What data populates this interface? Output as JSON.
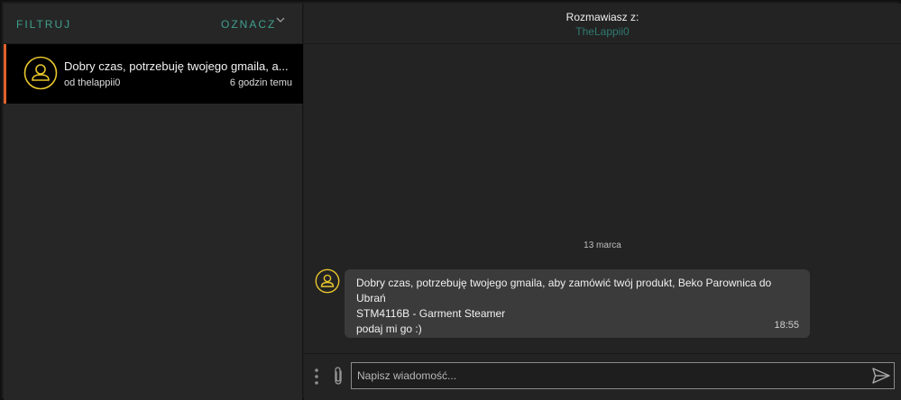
{
  "left": {
    "filter_label": "FILTRUJ",
    "mark_label": "OZNACZ",
    "mark_icon": "chevron-down-icon",
    "conversations": [
      {
        "title": "Dobry czas, potrzebuję twojego gmaila, a...",
        "from": "od thelappii0",
        "time": "6 godzin temu",
        "avatar_icon": "user-avatar-icon"
      }
    ]
  },
  "header": {
    "talking_with_label": "Rozmawiasz z:",
    "username": "TheLappii0"
  },
  "chat": {
    "date_separator": "13 marca",
    "messages": [
      {
        "lines": [
          "Dobry czas, potrzebuję twojego gmaila, aby zamówić twój produkt, Beko Parownica do Ubrań",
          "STM4116B - Garment Steamer",
          "podaj mi go :)"
        ],
        "time": "18:55",
        "avatar_icon": "user-avatar-icon"
      }
    ]
  },
  "composer": {
    "placeholder": "Napisz wiadomość...",
    "menu_icon": "more-vertical-icon",
    "attach_icon": "paperclip-icon",
    "send_icon": "send-icon"
  },
  "colors": {
    "accent_teal": "#3fa08f",
    "username_teal": "#2e7a70",
    "avatar_yellow": "#e8c62c",
    "active_border": "#e0622b"
  }
}
